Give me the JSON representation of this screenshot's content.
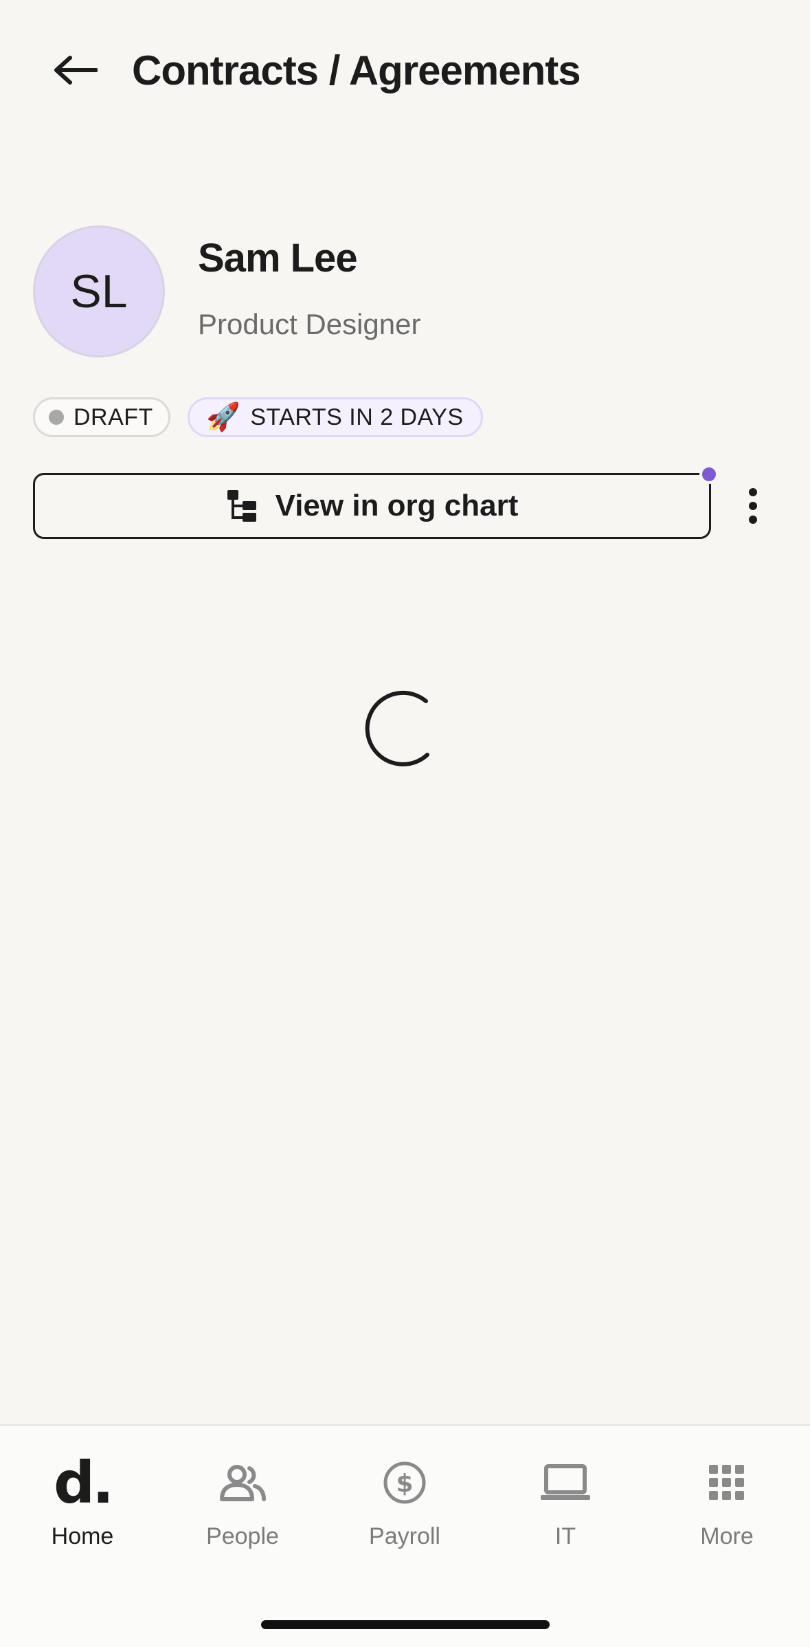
{
  "header": {
    "title": "Contracts / Agreements",
    "back_icon": "arrow-left-icon"
  },
  "profile": {
    "initials": "SL",
    "name": "Sam Lee",
    "role": "Product Designer",
    "avatar_color": "#e2d9f6"
  },
  "badges": {
    "draft_label": "DRAFT",
    "start_label": "STARTS IN 2 DAYS",
    "start_emoji": "🚀"
  },
  "actions": {
    "org_chart_label": "View in org chart",
    "org_chart_icon": "org-chart-icon",
    "more_icon": "kebab-menu-icon",
    "accent": "#7e5bd0"
  },
  "loading": {
    "icon": "loading-spinner-icon"
  },
  "bottom_nav": {
    "items": [
      {
        "label": "Home",
        "icon": "home-logo-icon",
        "active": true
      },
      {
        "label": "People",
        "icon": "people-icon",
        "active": false
      },
      {
        "label": "Payroll",
        "icon": "dollar-icon",
        "active": false
      },
      {
        "label": "IT",
        "icon": "laptop-icon",
        "active": false
      },
      {
        "label": "More",
        "icon": "grid-icon",
        "active": false
      }
    ],
    "home_logo_text": "d."
  }
}
